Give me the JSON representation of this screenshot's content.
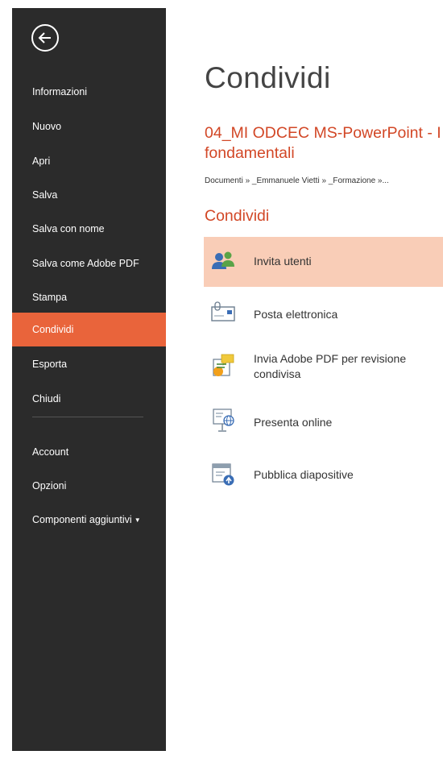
{
  "sidebar": {
    "items": [
      {
        "label": "Informazioni"
      },
      {
        "label": "Nuovo"
      },
      {
        "label": "Apri"
      },
      {
        "label": "Salva"
      },
      {
        "label": "Salva con nome"
      },
      {
        "label": "Salva come Adobe PDF"
      },
      {
        "label": "Stampa"
      },
      {
        "label": "Condividi",
        "active": true
      },
      {
        "label": "Esporta"
      },
      {
        "label": "Chiudi"
      },
      {
        "label": "Account"
      },
      {
        "label": "Opzioni"
      },
      {
        "label": "Componenti aggiuntivi"
      }
    ],
    "back_icon": "back-arrow-icon",
    "active_color": "#e9643b",
    "background": "#2b2b2b"
  },
  "main": {
    "title": "Condividi",
    "document": {
      "name": "04_MI ODCEC MS-PowerPoint - I fondamentali",
      "path": "Documenti » _Emmanuele Vietti » _Formazione »..."
    },
    "section_title": "Condividi",
    "share_options": [
      {
        "label": "Invita utenti",
        "icon": "people-icon",
        "selected": true
      },
      {
        "label": "Posta elettronica",
        "icon": "email-icon"
      },
      {
        "label": "Invia Adobe PDF per revisione condivisa",
        "icon": "adobe-review-icon"
      },
      {
        "label": "Presenta online",
        "icon": "present-online-icon"
      },
      {
        "label": "Pubblica diapositive",
        "icon": "publish-slides-icon"
      }
    ]
  },
  "colors": {
    "accent": "#d24726",
    "selected_bg": "#f9cdb7"
  }
}
